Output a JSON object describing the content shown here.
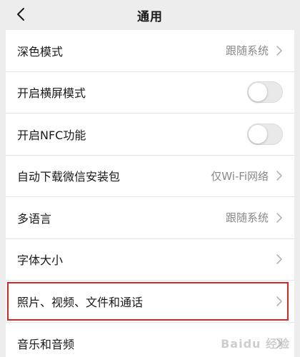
{
  "header": {
    "title": "通用",
    "back_icon": "chevron-left-icon"
  },
  "settings": [
    {
      "label": "深色模式",
      "value": "跟随系统",
      "type": "link"
    },
    {
      "label": "开启横屏模式",
      "type": "toggle",
      "on": false
    },
    {
      "label": "开启NFC功能",
      "type": "toggle",
      "on": false
    },
    {
      "label": "自动下载微信安装包",
      "value": "仅Wi-Fi网络",
      "type": "link"
    },
    {
      "label": "多语言",
      "value": "跟随系统",
      "type": "link"
    },
    {
      "label": "字体大小",
      "type": "link"
    },
    {
      "label": "照片、视频、文件和通话",
      "type": "link",
      "highlighted": true
    },
    {
      "label": "音乐和音频",
      "type": "link"
    }
  ],
  "colors": {
    "highlight": "#d9242e",
    "background": "#ededed",
    "value_text": "#8a8a8a"
  },
  "watermark": "Baidu 经验"
}
